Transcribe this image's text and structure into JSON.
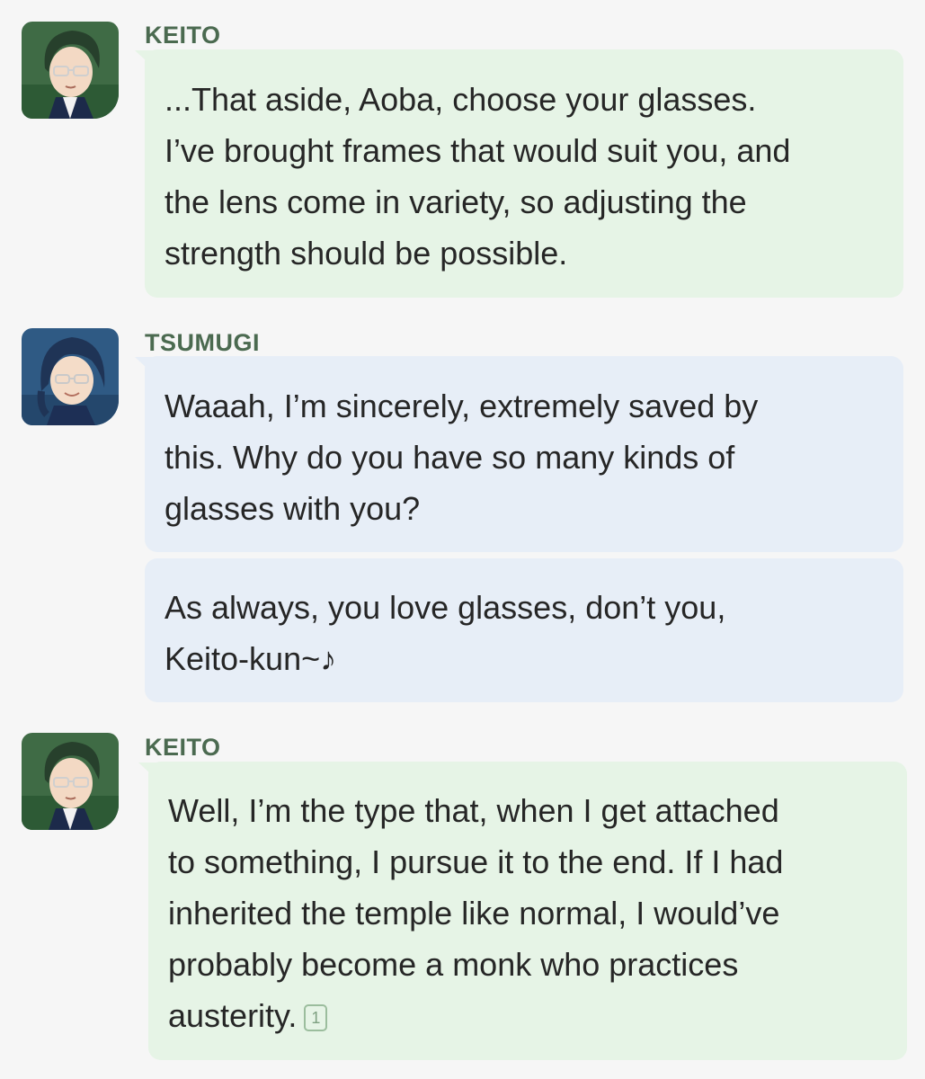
{
  "messages": [
    {
      "speaker": "KEITO",
      "text": "...That aside, Aoba, choose your glasses.\nI’ve brought frames that would suit you, and\nthe lens come in variety, so adjusting the\nstrength should be possible."
    },
    {
      "speaker": "TSUMUGI",
      "text": "Waaah, I’m sincerely, extremely saved by\nthis. Why do you have so many kinds of\nglasses with you?",
      "text2": "As always, you love glasses, don’t you,\nKeito-kun~♪"
    },
    {
      "speaker": "KEITO",
      "text": "Well, I’m the type that, when I get attached\nto something, I pursue it to the end. If I had\ninherited the temple like normal, I would’ve\nprobably become a monk who practices\nausterity.",
      "footnote": "1"
    }
  ],
  "icons": {
    "keito_avatar": "keito-avatar-icon",
    "tsumugi_avatar": "tsumugi-avatar-icon"
  },
  "colors": {
    "keito_bubble": "#e6f4e6",
    "tsumugi_bubble": "#e7eef7",
    "speaker_name": "#4b6a50",
    "background": "#f6f6f6"
  }
}
